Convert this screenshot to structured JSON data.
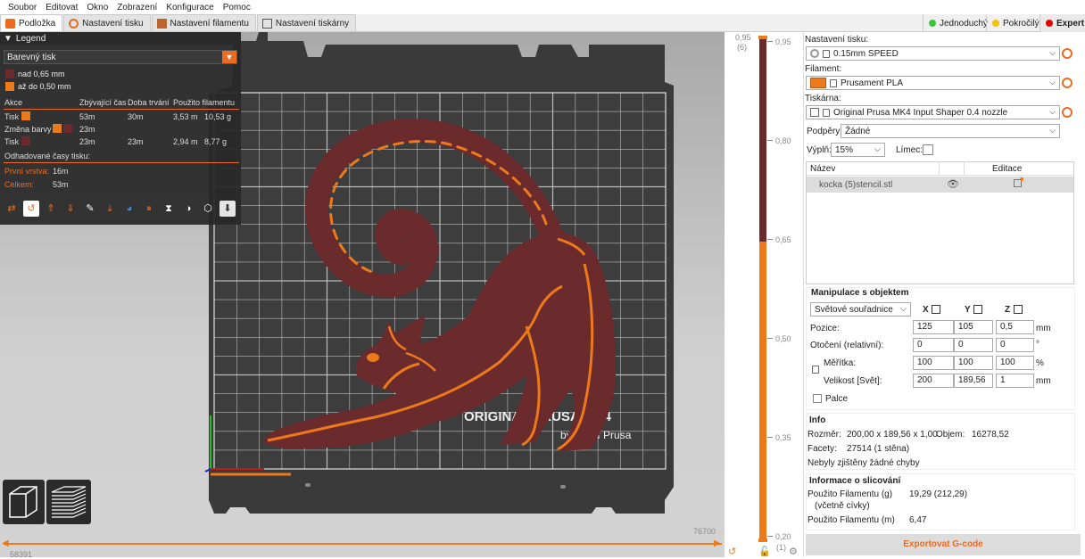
{
  "menu": [
    "Soubor",
    "Editovat",
    "Okno",
    "Zobrazení",
    "Konfigurace",
    "Pomoc"
  ],
  "tabs": [
    {
      "label": "Podložka",
      "icon": "bed-icon",
      "active": true
    },
    {
      "label": "Nastavení tisku",
      "icon": "gear-icon",
      "active": false
    },
    {
      "label": "Nastavení filamentu",
      "icon": "filament-icon",
      "active": false
    },
    {
      "label": "Nastavení tiskárny",
      "icon": "printer-icon",
      "active": false
    }
  ],
  "modes": [
    {
      "label": "Jednoduchý",
      "color": "#38c536"
    },
    {
      "label": "Pokročilý",
      "color": "#f5c200"
    },
    {
      "label": "Expert",
      "color": "#e00000"
    }
  ],
  "legend": {
    "title": "Legend",
    "view_type": "Barevný tisk",
    "ranges": [
      {
        "label": "nad 0,65 mm",
        "color": "#6b2a2c"
      },
      {
        "label": "až do 0,50 mm",
        "color": "#ed7a1a"
      }
    ],
    "table_headers": [
      "Akce",
      "Zbývající čas",
      "Doba trvání",
      "Použito filamentu"
    ],
    "rows": [
      {
        "action": "Tisk",
        "color": "#ed7a1a",
        "remaining": "53m",
        "duration": "30m",
        "used": "3,53 m",
        "weight": "10,53 g"
      },
      {
        "action": "Změna barvy",
        "color": "#ed7a1a",
        "color2": "#6b2a2c",
        "remaining": "23m",
        "duration": "",
        "used": "",
        "weight": ""
      },
      {
        "action": "Tisk",
        "color": "#6b2a2c",
        "remaining": "23m",
        "duration": "23m",
        "used": "2,94 m",
        "weight": "8,77 g"
      }
    ],
    "est_title": "Odhadované časy tisku:",
    "first_layer_label": "První vrstva:",
    "first_layer_value": "16m",
    "total_label": "Celkem:",
    "total_value": "53m"
  },
  "bed": {
    "model_label": "ORIGINAL PRUSA MK4",
    "model_sub": "by Josef Prusa"
  },
  "vslider": {
    "top": "0,95",
    "top_sub": "(6)",
    "ticks": [
      "0,95",
      "0,80",
      "0,65",
      "0,50",
      "0,35",
      "0,20"
    ],
    "bottom_sub": "(1)"
  },
  "hslider": {
    "left": "58391",
    "right": "76700"
  },
  "right": {
    "print_settings_label": "Nastavení tisku:",
    "print_settings_value": "0.15mm SPEED",
    "filament_label": "Filament:",
    "filament_value": "Prusament PLA",
    "filament_color": "#ed7a1a",
    "printer_label": "Tiskárna:",
    "printer_value": "Original Prusa MK4 Input Shaper 0.4 nozzle",
    "supports_label": "Podpěry:",
    "supports_value": "Žádné",
    "infill_label": "Výplň:",
    "infill_value": "15%",
    "brim_label": "Límec:",
    "list_headers": [
      "Název",
      "Editace"
    ],
    "object_name": "kocka (5)stencil.stl",
    "manip_title": "Manipulace s objektem",
    "coord_value": "Světové souřadnice",
    "axes": [
      "X",
      "Y",
      "Z"
    ],
    "position_label": "Pozice:",
    "position": [
      "125",
      "105",
      "0,5"
    ],
    "position_unit": "mm",
    "rotation_label": "Otočení (relativní):",
    "rotation": [
      "0",
      "0",
      "0"
    ],
    "rotation_unit": "°",
    "scale_label": "Měřítka:",
    "scale": [
      "100",
      "100",
      "100"
    ],
    "scale_unit": "%",
    "size_label": "Velikost [Svět]:",
    "size": [
      "200",
      "189,56",
      "1"
    ],
    "size_unit": "mm",
    "inches_label": "Palce",
    "info_title": "Info",
    "size_info_label": "Rozměr:",
    "size_info_value": "200,00 x 189,56 x 1,00",
    "volume_label": "Objem:",
    "volume_value": "16278,52",
    "facets_label": "Facety:",
    "facets_value": "27514 (1 stěna)",
    "errors_text": "Nebyly zjištěny žádné chyby",
    "slice_title": "Informace o slicování",
    "fil_g_label": "Použito Filamentu (g)",
    "fil_g_sub": "(včetně cívky)",
    "fil_g_value": "19,29 (212,29)",
    "fil_m_label": "Použito Filamentu (m)",
    "fil_m_value": "6,47",
    "export_label": "Exportovat G-code"
  }
}
